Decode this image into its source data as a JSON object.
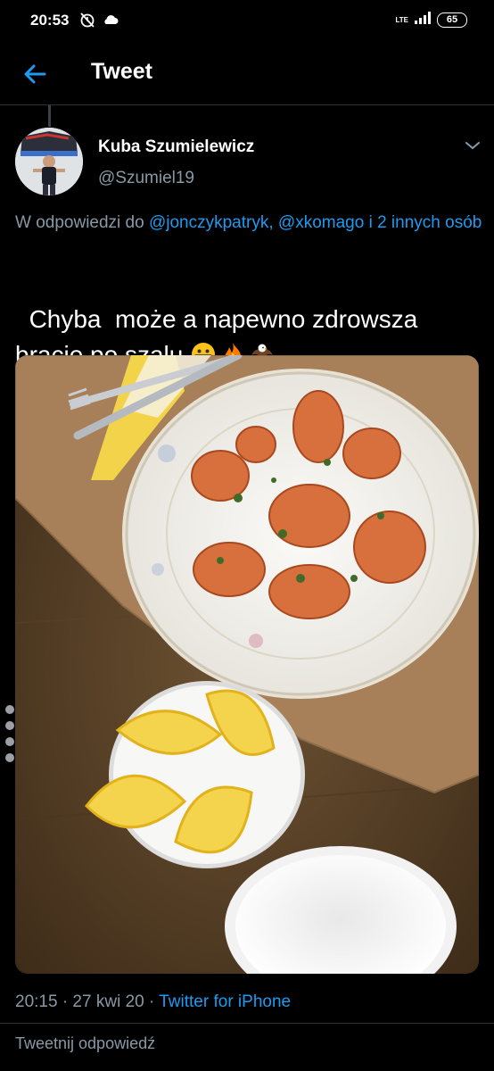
{
  "status_bar": {
    "time": "20:53",
    "network": "LTE",
    "battery": "65"
  },
  "header": {
    "title": "Tweet"
  },
  "tweet": {
    "author_name": "Kuba Szumielewicz",
    "author_handle": "@Szumiel19",
    "reply_prefix": "W odpowiedzi do ",
    "reply_user_1": "@jonczykpatryk",
    "reply_sep": ", ",
    "reply_user_2": "@xkomago",
    "reply_others": " i 2 innych osób",
    "text_line_1": "Chyba  może a napewno zdrowsza",
    "text_line_2": "bracie po szalu ",
    "emojis": [
      "grinning-face",
      "fire",
      "eagle"
    ],
    "timestamp": "20:15 · 27 kwi 20 · ",
    "source": "Twitter for iPhone"
  },
  "reply_bar": {
    "placeholder": "Tweetnij odpowiedź"
  },
  "colors": {
    "background": "#000000",
    "accent": "#1d9bf0",
    "secondary_text": "#8899a6",
    "divider": "#2f3336"
  }
}
